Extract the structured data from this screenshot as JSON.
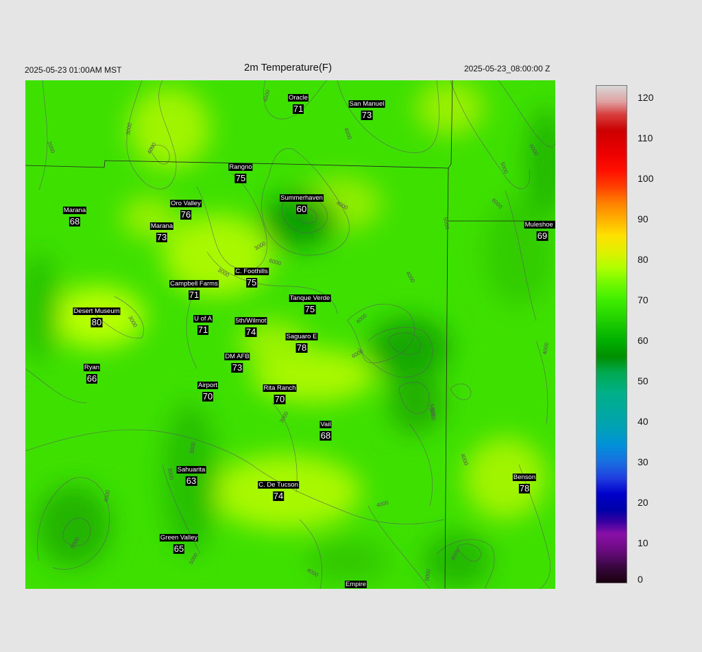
{
  "header": {
    "local_time": "2025-05-23 01:00AM MST",
    "title": "2m Temperature(F)",
    "valid_time": "2025-05-23_08:00:00 Z"
  },
  "map": {
    "base_color": "#3ee000",
    "stations": [
      {
        "name": "Oracle",
        "value": "71"
      },
      {
        "name": "San Manuel",
        "value": "73"
      },
      {
        "name": "Rangno",
        "value": "75"
      },
      {
        "name": "Summerhaven",
        "value": "60"
      },
      {
        "name": "Oro Valley",
        "value": "76"
      },
      {
        "name": "Marana",
        "value": "68"
      },
      {
        "name": "Marana",
        "value": "73"
      },
      {
        "name": "Muleshoe R",
        "value": "69"
      },
      {
        "name": "C. Foothills",
        "value": "75"
      },
      {
        "name": "Campbell Farms",
        "value": "71"
      },
      {
        "name": "Tanque Verde",
        "value": "75"
      },
      {
        "name": "Desert Museum",
        "value": "80"
      },
      {
        "name": "U of A",
        "value": "71"
      },
      {
        "name": "5th/Wilmot",
        "value": "74"
      },
      {
        "name": "Saguaro E",
        "value": "78"
      },
      {
        "name": "DM AFB",
        "value": "73"
      },
      {
        "name": "Ryan",
        "value": "66"
      },
      {
        "name": "Airport",
        "value": "70"
      },
      {
        "name": "Rita Ranch",
        "value": "70"
      },
      {
        "name": "Vail",
        "value": "68"
      },
      {
        "name": "Sahuarita",
        "value": "63"
      },
      {
        "name": "C. De Tucson",
        "value": "74"
      },
      {
        "name": "Benson",
        "value": "78"
      },
      {
        "name": "Green Valley",
        "value": "65"
      },
      {
        "name": "Empire",
        "value": ""
      }
    ],
    "contour_labels": [
      "4000",
      "2000",
      "3000",
      "4000",
      "4000",
      "6000",
      "5000",
      "6000",
      "4000",
      "5000",
      "3000",
      "3000",
      "4000",
      "6000",
      "3000",
      "4000",
      "4000",
      "6000",
      "5000",
      "3000",
      "4000",
      "3000",
      "4000",
      "5000",
      "4000",
      "5000",
      "3000",
      "4000",
      "5000",
      "5000",
      "6000"
    ]
  },
  "colorbar": {
    "ticks": [
      0,
      10,
      20,
      30,
      40,
      50,
      60,
      70,
      80,
      90,
      100,
      110,
      120
    ],
    "min": 0,
    "max": 123,
    "colors": [
      {
        "v": 0,
        "c": "#1a0010"
      },
      {
        "v": 4,
        "c": "#3a0840"
      },
      {
        "v": 8,
        "c": "#6a0a80"
      },
      {
        "v": 12,
        "c": "#8a10a8"
      },
      {
        "v": 15,
        "c": "#3a00a0"
      },
      {
        "v": 18,
        "c": "#0000a8"
      },
      {
        "v": 22,
        "c": "#0000cc"
      },
      {
        "v": 26,
        "c": "#2040e0"
      },
      {
        "v": 30,
        "c": "#1870e0"
      },
      {
        "v": 34,
        "c": "#0090d8"
      },
      {
        "v": 38,
        "c": "#00a0b8"
      },
      {
        "v": 42,
        "c": "#00a8a0"
      },
      {
        "v": 47,
        "c": "#00b088"
      },
      {
        "v": 52,
        "c": "#00a850"
      },
      {
        "v": 56,
        "c": "#009000"
      },
      {
        "v": 60,
        "c": "#00b000"
      },
      {
        "v": 65,
        "c": "#20d000"
      },
      {
        "v": 70,
        "c": "#40ee00"
      },
      {
        "v": 74,
        "c": "#70f800"
      },
      {
        "v": 78,
        "c": "#b0ff00"
      },
      {
        "v": 82,
        "c": "#e0f000"
      },
      {
        "v": 86,
        "c": "#ffe000"
      },
      {
        "v": 90,
        "c": "#ffb000"
      },
      {
        "v": 94,
        "c": "#ff8000"
      },
      {
        "v": 98,
        "c": "#ff4000"
      },
      {
        "v": 102,
        "c": "#ff1000"
      },
      {
        "v": 106,
        "c": "#ee0000"
      },
      {
        "v": 112,
        "c": "#cc0000"
      },
      {
        "v": 116,
        "c": "#d84040"
      },
      {
        "v": 119,
        "c": "#e0a0a0"
      },
      {
        "v": 123,
        "c": "#d8d8d8"
      }
    ]
  }
}
